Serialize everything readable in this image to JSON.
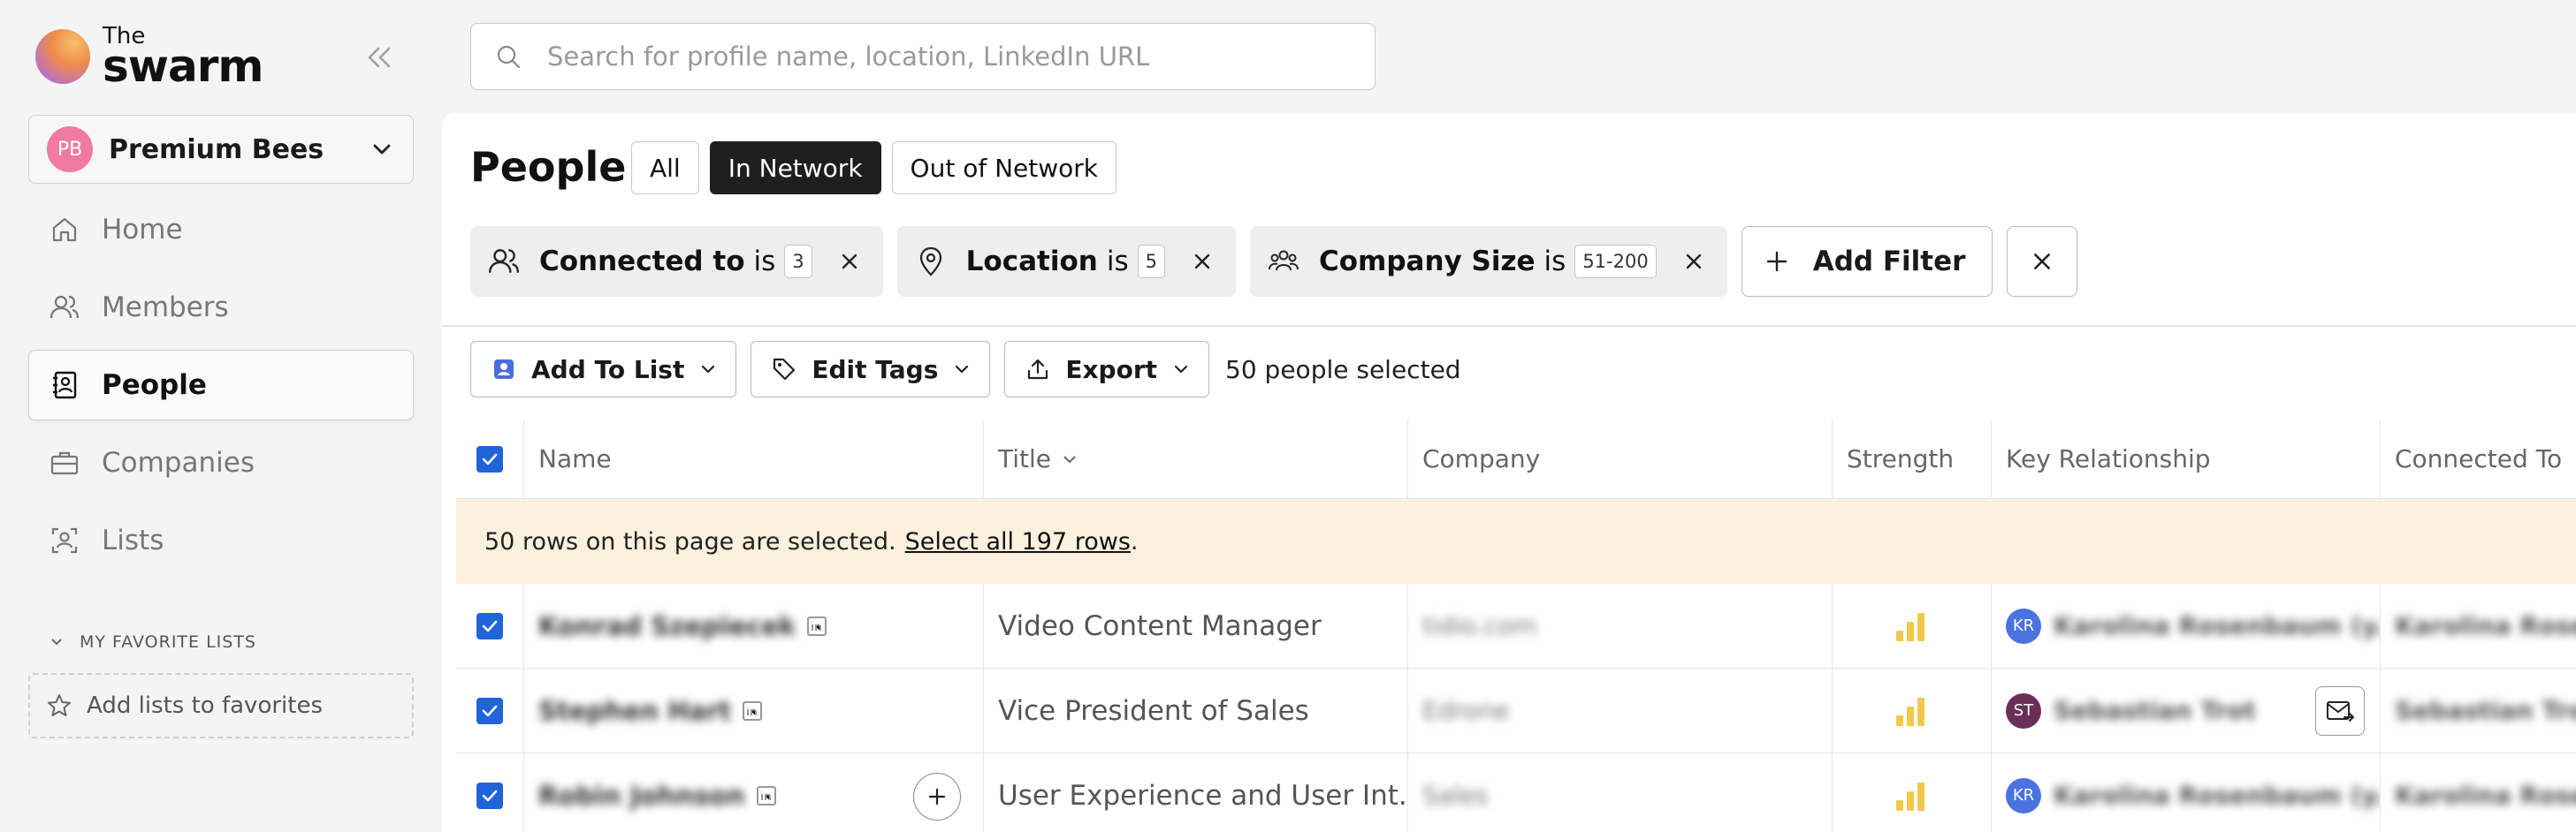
{
  "app": {
    "logo_the": "The",
    "logo_name": "swarm"
  },
  "team": {
    "initials": "PB",
    "name": "Premium Bees",
    "avatar_color": "#f07aa0"
  },
  "nav": {
    "items": [
      {
        "label": "Home",
        "icon": "home-icon",
        "active": false
      },
      {
        "label": "Members",
        "icon": "users-icon",
        "active": false
      },
      {
        "label": "People",
        "icon": "contact-book-icon",
        "active": true
      },
      {
        "label": "Companies",
        "icon": "briefcase-icon",
        "active": false
      },
      {
        "label": "Lists",
        "icon": "scan-user-icon",
        "active": false
      }
    ]
  },
  "favorites": {
    "header": "MY FAVORITE LISTS",
    "add_label": "Add lists to favorites"
  },
  "search": {
    "placeholder": "Search for profile name, location, LinkedIn URL",
    "value": ""
  },
  "page": {
    "title": "People",
    "tabs": [
      {
        "label": "All",
        "active": false
      },
      {
        "label": "In Network",
        "active": true
      },
      {
        "label": "Out of Network",
        "active": false
      }
    ]
  },
  "filters": {
    "chips": [
      {
        "label": "Connected to",
        "op": "is",
        "value": "3",
        "icon": "users-icon"
      },
      {
        "label": "Location",
        "op": "is",
        "value": "5",
        "icon": "location-pin-icon"
      },
      {
        "label": "Company Size",
        "op": "is",
        "value": "51-200",
        "icon": "group-icon"
      }
    ],
    "add_label": "Add Filter"
  },
  "toolbar": {
    "add_to_list": "Add To List",
    "edit_tags": "Edit Tags",
    "export": "Export",
    "selected_text": "50 people selected"
  },
  "table": {
    "columns": {
      "name": "Name",
      "title": "Title",
      "company": "Company",
      "strength": "Strength",
      "key_relationship": "Key Relationship",
      "connected_to": "Connected To"
    },
    "banner": {
      "text": "50 rows on this page are selected.",
      "link": "Select all 197 rows",
      "suffix": "."
    },
    "rows": [
      {
        "name": "Konrad Szepiecek",
        "title": "Video Content Manager",
        "company": "tidio.com",
        "strength": 3,
        "kr_initials": "KR",
        "kr_color": "#4a72e0",
        "kr_name": "Karolina Rosenbaum (y...",
        "connected_to": "Karolina Rosen"
      },
      {
        "name": "Stephen Hart",
        "title": "Vice President of Sales",
        "company": "Edrone",
        "strength": 3,
        "kr_initials": "ST",
        "kr_color": "#6b2e57",
        "kr_name": "Sebastian Trot",
        "connected_to": "Sebastian Trot"
      },
      {
        "name": "Robin Johnson",
        "title": "User Experience and User Int...",
        "company": "Sales",
        "strength": 3,
        "kr_initials": "KR",
        "kr_color": "#4a72e0",
        "kr_name": "Karolina Rosenbaum (y...",
        "connected_to": "Karolina Rosen"
      }
    ]
  },
  "colors": {
    "accent_blue": "#1f64d8",
    "strength_yellow": "#f2c94c",
    "banner_bg": "#fdf0dd"
  }
}
